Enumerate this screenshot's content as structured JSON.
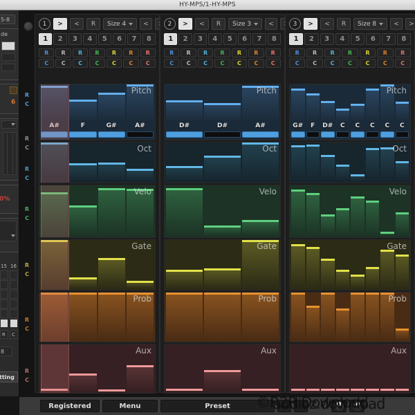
{
  "window": {
    "title": "HY-MPS/1-HY-MPS"
  },
  "host_panel": {
    "label_56": "5-8",
    "label_mode": "de",
    "label_percent": "0%",
    "label_15": "15",
    "label_16": "16",
    "label_r": "R",
    "label_c": "C",
    "label_8": "8",
    "label_setting": "tting"
  },
  "gutter": {
    "rows": [
      {
        "name": "pitch",
        "r": "R",
        "c": "C",
        "color": "#5b9bd5"
      },
      {
        "name": "oct",
        "r": "R",
        "c": "C",
        "color": "#8e8e8e"
      },
      {
        "name": "oct2",
        "r": "R",
        "c": "C",
        "color": "#4f9fc0"
      },
      {
        "name": "velo",
        "r": "R",
        "c": "C",
        "color": "#4ea860"
      },
      {
        "name": "gate",
        "r": "R",
        "c": "C",
        "color": "#b5a93a"
      },
      {
        "name": "prob",
        "r": "R",
        "c": "C",
        "color": "#c07a34"
      },
      {
        "name": "aux",
        "r": "R",
        "c": "C",
        "color": "#b4706e"
      }
    ]
  },
  "toolbar_common": {
    "play_label": ">",
    "prev_label": "<",
    "rand_label": "R",
    "left_label": "<",
    "right_label": ">",
    "steps": [
      "1",
      "2",
      "3",
      "4",
      "5",
      "6",
      "7",
      "8"
    ],
    "active_step": "1",
    "rc_r": "R",
    "rc_c": "C",
    "rc_colors": [
      "#4f8fd6",
      "#b9b9b9",
      "#4bb4d8",
      "#46b456",
      "#d9d436",
      "#d9862b",
      "#e0736c"
    ]
  },
  "lane_names": {
    "pitch": "Pitch",
    "oct": "Oct",
    "velo": "Velo",
    "gate": "Gate",
    "prob": "Prob",
    "aux": "Aux"
  },
  "groups": [
    {
      "id": "1",
      "number": "1",
      "size_label": "Size 4",
      "steps": 4,
      "playhead_step": 1,
      "pitch": {
        "notes": [
          "A#",
          "F",
          "G#",
          "A#"
        ],
        "values": [
          0.97,
          0.6,
          0.78,
          1.0
        ],
        "strip_on": [
          true,
          true,
          true,
          false
        ]
      },
      "oct": {
        "values": [
          1.0,
          0.46,
          0.48,
          0.32
        ]
      },
      "velo": {
        "values": [
          0.86,
          0.6,
          0.95,
          0.93
        ]
      },
      "gate": {
        "values": [
          1.0,
          0.23,
          0.63,
          0.15
        ]
      },
      "prob": {
        "values": [
          1.0,
          1.0,
          1.0,
          1.0
        ]
      },
      "aux": {
        "values": [
          0.06,
          0.38,
          0.05,
          0.56
        ]
      }
    },
    {
      "id": "2",
      "number": "2",
      "size_label": "Size 3",
      "steps": 3,
      "playhead_step": 0,
      "pitch": {
        "notes": [
          "D#",
          "D#",
          "A#"
        ],
        "values": [
          0.58,
          0.5,
          0.96
        ],
        "strip_on": [
          true,
          false,
          true
        ]
      },
      "oct": {
        "values": [
          0.4,
          0.66,
          1.0
        ]
      },
      "velo": {
        "values": [
          0.94,
          0.2,
          0.32
        ]
      },
      "gate": {
        "values": [
          0.38,
          0.42,
          1.0
        ]
      },
      "prob": {
        "values": [
          1.0,
          1.0,
          1.0
        ]
      },
      "aux": {
        "values": [
          0.06,
          0.46,
          0.06
        ]
      }
    },
    {
      "id": "3",
      "number": "3",
      "size_label": "Size 8",
      "steps": 8,
      "playhead_step": 0,
      "pitch": {
        "notes": [
          "G#",
          "F",
          "D#",
          "C",
          "C",
          "C",
          "C",
          "C"
        ],
        "values": [
          0.88,
          0.76,
          0.55,
          0.36,
          0.48,
          0.88,
          1.0,
          0.54
        ],
        "strip_on": [
          true,
          false,
          true,
          false,
          true,
          false,
          true,
          false
        ]
      },
      "oct": {
        "values": [
          0.92,
          0.95,
          0.68,
          0.42,
          0.18,
          0.86,
          0.88,
          0.52
        ]
      },
      "velo": {
        "values": [
          0.92,
          0.85,
          0.42,
          0.55,
          0.78,
          0.7,
          0.08,
          0.46
        ]
      },
      "gate": {
        "values": [
          0.92,
          0.86,
          0.62,
          0.38,
          0.28,
          0.44,
          0.8,
          0.7
        ]
      },
      "prob": {
        "values": [
          1.0,
          0.72,
          1.0,
          0.66,
          1.0,
          1.0,
          1.0,
          0.24
        ]
      },
      "aux": {
        "values": [
          0.06,
          0.06,
          0.06,
          0.06,
          0.06,
          0.06,
          0.06,
          0.06
        ]
      }
    }
  ],
  "bottom": {
    "registered_label": "Registered",
    "menu_label": "Menu",
    "preset_label": "Preset",
    "small_a": "",
    "small_b": ""
  },
  "watermark": {
    "line1": "©R2R Download",
    "line2": "audioz.download"
  },
  "colors": {
    "pitch": "#63b0ef",
    "oct": "#62b8e8",
    "velo": "#5fd07f",
    "gate": "#e2e24a",
    "prob": "#e8922f",
    "aux": "#f09a9a"
  }
}
